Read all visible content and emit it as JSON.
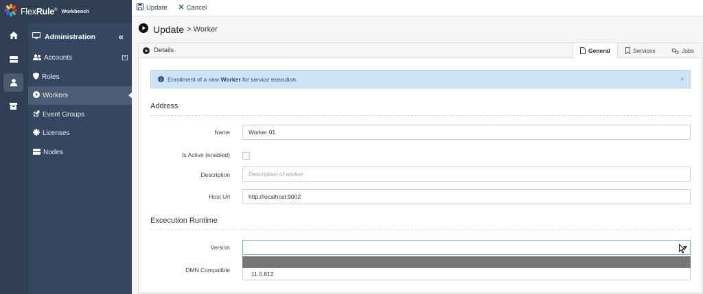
{
  "app": {
    "brand_flex": "Flex",
    "brand_rule": "Rule",
    "brand_reg": "®",
    "brand_sub": "Workbench",
    "accent": "#2f3e52"
  },
  "rail": {
    "items": [
      {
        "name": "home-icon"
      },
      {
        "name": "server-icon"
      },
      {
        "name": "user-icon"
      },
      {
        "name": "archive-icon"
      }
    ]
  },
  "sidebar": {
    "section_title": "Administration",
    "collapse_glyph": "«",
    "items": [
      {
        "label": "Accounts",
        "icon": "users-icon"
      },
      {
        "label": "Roles",
        "icon": "shield-icon"
      },
      {
        "label": "Workers",
        "icon": "play-circle-icon"
      },
      {
        "label": "Event Groups",
        "icon": "external-link-icon"
      },
      {
        "label": "Licenses",
        "icon": "certificate-icon"
      },
      {
        "label": "Nodes",
        "icon": "server-icon"
      }
    ]
  },
  "toolbar": {
    "update_label": "Update",
    "cancel_label": "Cancel"
  },
  "page": {
    "title": "Update",
    "subtitle": "> Worker"
  },
  "panel": {
    "header_label": "Details",
    "tabs": [
      {
        "label": "General",
        "icon": "file-icon",
        "active": true
      },
      {
        "label": "Services",
        "icon": "bookmark-icon",
        "active": false
      },
      {
        "label": "Jobs",
        "icon": "cogs-icon",
        "active": false
      }
    ]
  },
  "alert": {
    "prefix": "Enrollment of a new",
    "bold": "Worker",
    "suffix": "for service execution.",
    "close": "×"
  },
  "form": {
    "address_title": "Address",
    "runtime_title": "Excecution Runtime",
    "name_label": "Name",
    "name_value": "Worker 01",
    "active_label": "Is Active (enabled)",
    "active_checked": false,
    "description_label": "Description",
    "description_placeholder": "Description of worker",
    "host_label": "Host Url",
    "host_value": "http://localhost:9002",
    "version_label": "Version",
    "version_value": "",
    "dmn_label": "DMN Compatible",
    "version_options": [
      "",
      "11.0.812"
    ]
  }
}
